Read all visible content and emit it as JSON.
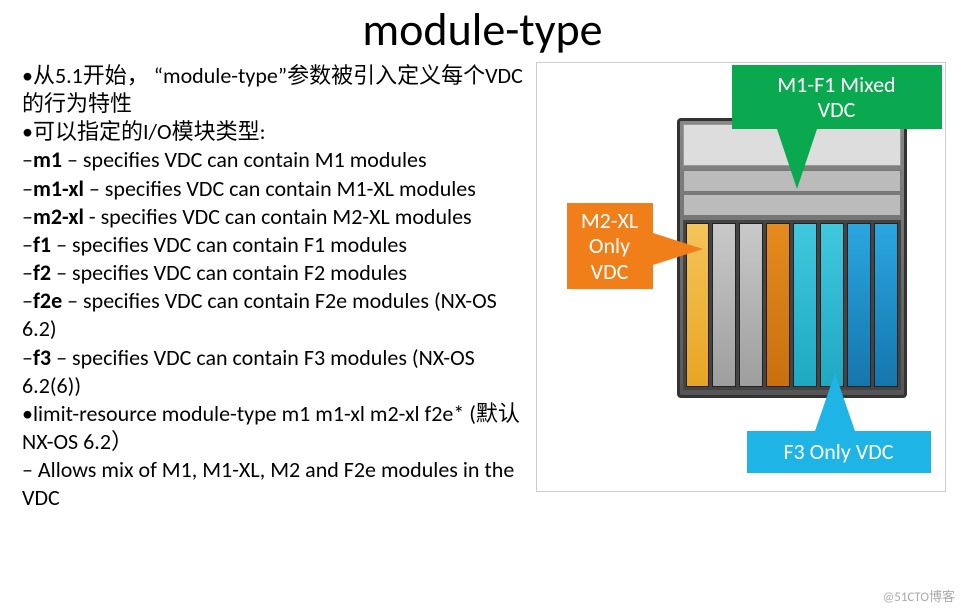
{
  "title": "module-type",
  "bullets": {
    "b1_pre": "•从5.1开始， “",
    "b1_mid": "module-type",
    "b1_post": "”参数被引入定义每个VDC的行为特性",
    "b2": "•可以指定的I/O模块类型:",
    "m1_k": "m1",
    "m1_t": " – specifies VDC can contain M1 modules",
    "m1xl_k": "m1-xl",
    "m1xl_t": " – specifies VDC can contain M1-XL modules",
    "m2xl_k": "m2-xl",
    "m2xl_t": " - specifies VDC can contain M2-XL modules",
    "f1_k": "f1",
    "f1_t": " – specifies VDC can contain F1 modules",
    "f2_k": "f2",
    "f2_t": " – specifies VDC can contain F2 modules",
    "f2e_k": "f2e",
    "f2e_t": " – specifies VDC can contain F2e modules (NX-OS 6.2)",
    "f3_k": "f3",
    "f3_t": " – specifies VDC can contain F3 modules (NX-OS 6.2(6))",
    "limit": "•limit-resource module-type m1 m1-xl m2-xl f2e* (默认 NX-OS 6.2）",
    "allow": " – Allows mix of M1, M1-XL, M2 and F2e modules in the VDC",
    "dash": "–"
  },
  "callouts": {
    "green_l1": "M1-F1 Mixed",
    "green_l2": "VDC",
    "orange_l1": "M2-XL",
    "orange_l2": "Only",
    "orange_l3": "VDC",
    "blue": "F3 Only VDC"
  },
  "watermark": "@51CTO博客"
}
